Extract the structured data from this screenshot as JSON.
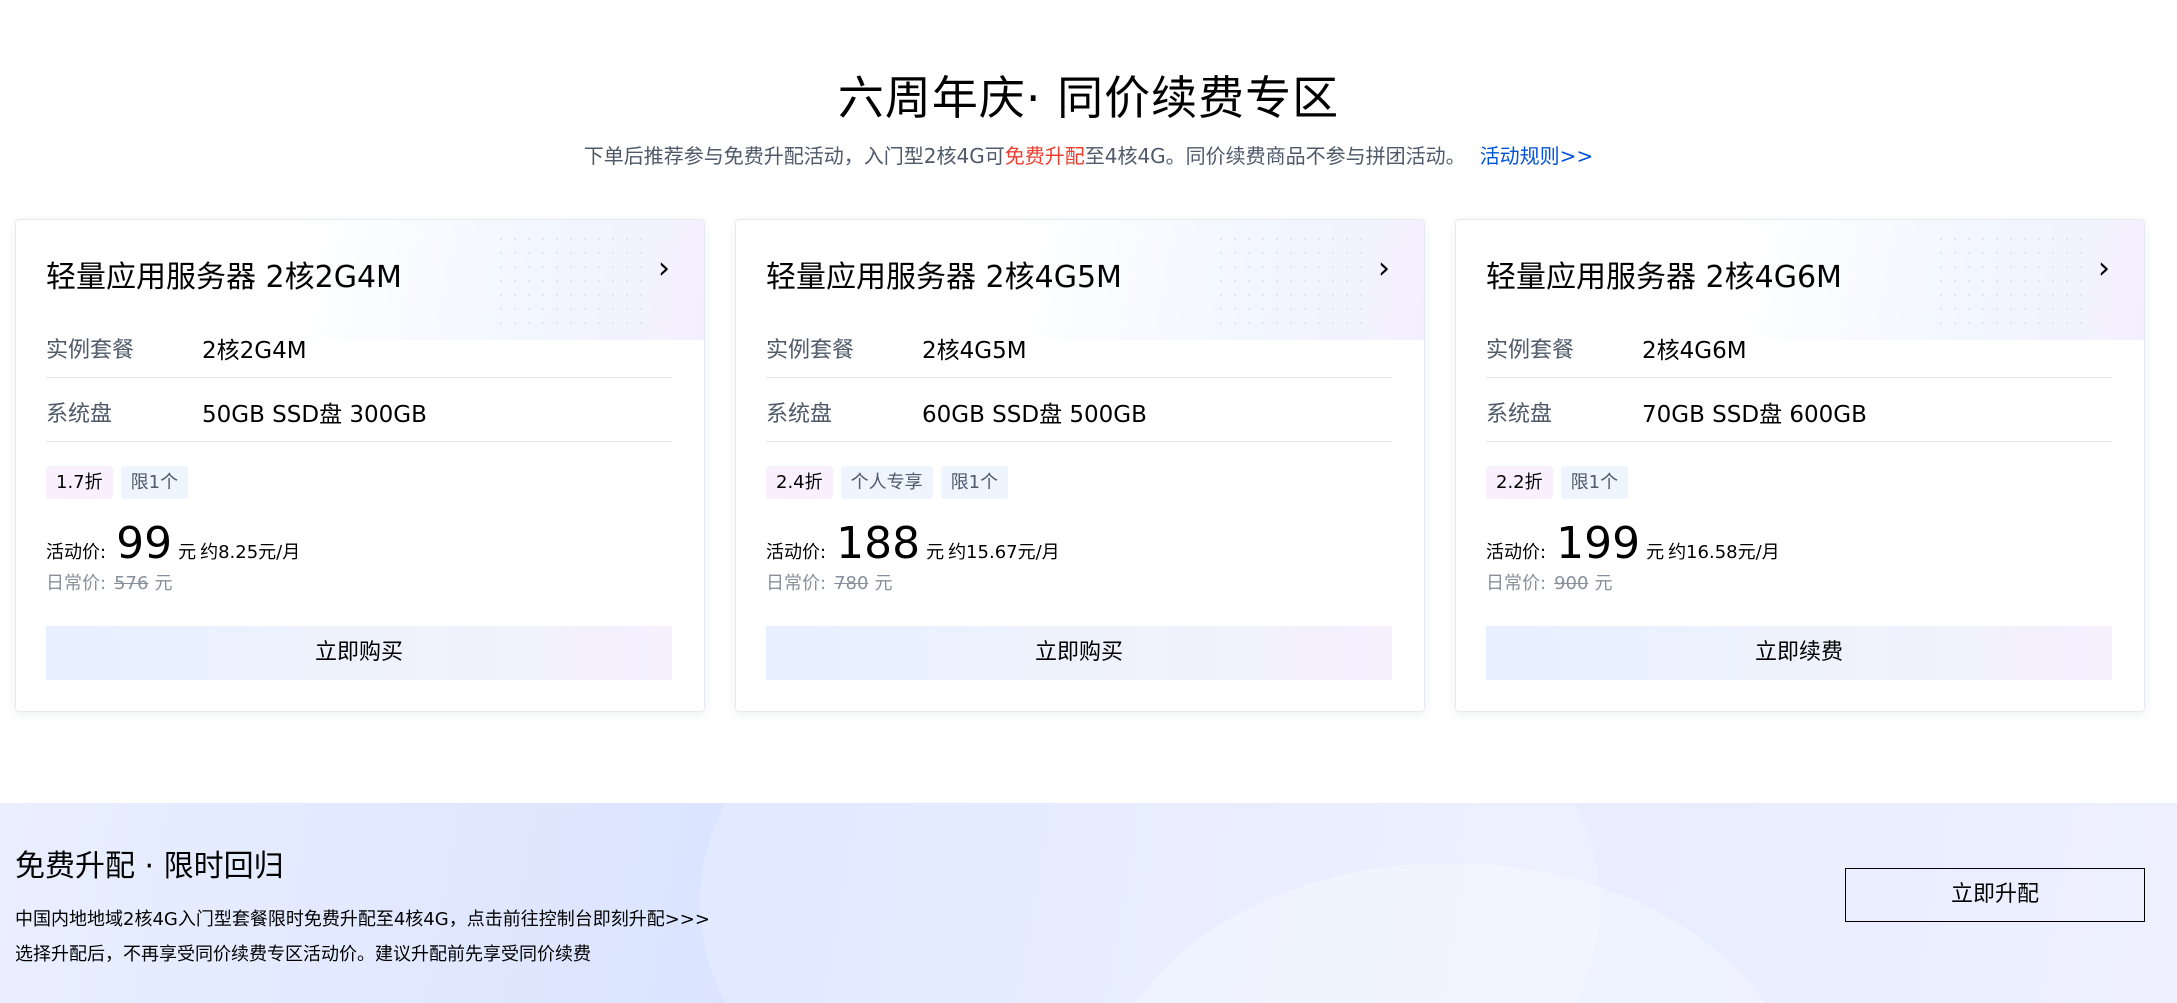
{
  "header": {
    "title": "六周年庆· 同价续费专区",
    "subtitle_prefix": "下单后推荐参与免费升配活动，入门型2核4G可",
    "subtitle_highlight": "免费升配",
    "subtitle_suffix": "至4核4G。同价续费商品不参与拼团活动。",
    "rules_link": "活动规则>>"
  },
  "colors": {
    "highlight": "#ed3e2f",
    "link": "#0052d9",
    "muted_text": "#4e5969"
  },
  "icons": {
    "card_arrow": "chevron-right-icon"
  },
  "cards": [
    {
      "title": "轻量应用服务器 2核2G4M",
      "spec_label": "实例套餐",
      "spec_value": "2核2G4M",
      "disk_label": "系统盘",
      "disk_value": "50GB SSD盘 300GB",
      "tags": [
        "1.7折",
        "限1个"
      ],
      "price_label": "活动价:",
      "price": "99",
      "price_unit": "元",
      "price_monthly": "约8.25元/月",
      "orig_label": "日常价:",
      "orig_price": "576",
      "orig_unit": "元",
      "button": "立即购买"
    },
    {
      "title": "轻量应用服务器 2核4G5M",
      "spec_label": "实例套餐",
      "spec_value": "2核4G5M",
      "disk_label": "系统盘",
      "disk_value": "60GB SSD盘 500GB",
      "tags": [
        "2.4折",
        "个人专享",
        "限1个"
      ],
      "price_label": "活动价:",
      "price": "188",
      "price_unit": "元",
      "price_monthly": "约15.67元/月",
      "orig_label": "日常价:",
      "orig_price": "780",
      "orig_unit": "元",
      "button": "立即购买"
    },
    {
      "title": "轻量应用服务器 2核4G6M",
      "spec_label": "实例套餐",
      "spec_value": "2核4G6M",
      "disk_label": "系统盘",
      "disk_value": "70GB SSD盘 600GB",
      "tags": [
        "2.2折",
        "限1个"
      ],
      "price_label": "活动价:",
      "price": "199",
      "price_unit": "元",
      "price_monthly": "约16.58元/月",
      "orig_label": "日常价:",
      "orig_price": "900",
      "orig_unit": "元",
      "button": "立即续费"
    }
  ],
  "banner": {
    "title": "免费升配 · 限时回归",
    "line1": "中国内地地域2核4G入门型套餐限时免费升配至4核4G，点击前往控制台即刻升配>>>",
    "line2": "选择升配后，不再享受同价续费专区活动价。建议升配前先享受同价续费",
    "button": "立即升配"
  }
}
